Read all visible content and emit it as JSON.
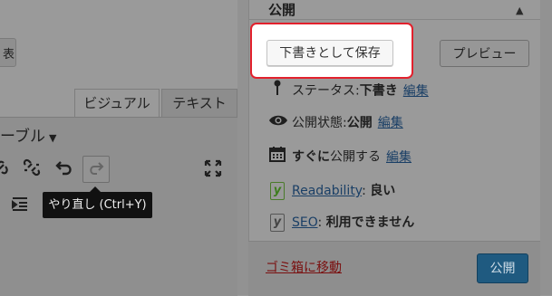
{
  "editor": {
    "top_button_label": "表",
    "tabs": [
      {
        "label": "ビジュアル"
      },
      {
        "label": "テキスト"
      }
    ],
    "format_select": {
      "value": "ーブル"
    },
    "toolbar_icons": [
      "link-icon",
      "unlink-icon",
      "undo-icon",
      "redo-icon",
      "fullscreen-icon",
      "indent-icon"
    ],
    "tooltip": "やり直し (Ctrl+Y)"
  },
  "publish_box": {
    "title": "公開",
    "save_draft_label": "下書きとして保存",
    "preview_label": "プレビュー",
    "status": {
      "label": "ステータス:",
      "value": "下書き",
      "edit": "編集"
    },
    "visibility": {
      "label": "公開状態:",
      "value": "公開",
      "edit": "編集"
    },
    "schedule": {
      "strong": "すぐに",
      "label": "公開する",
      "edit": "編集"
    },
    "readability": {
      "link": "Readability",
      "value": "良い"
    },
    "seo": {
      "link": "SEO",
      "value": "利用できません"
    },
    "trash_label": "ゴミ箱に移動",
    "publish_label": "公開"
  },
  "colors": {
    "highlight_border": "#e2212d",
    "publish_button": "#1f5a80",
    "link": "#1a3f66",
    "yoast_green": "#3d7d1c"
  }
}
